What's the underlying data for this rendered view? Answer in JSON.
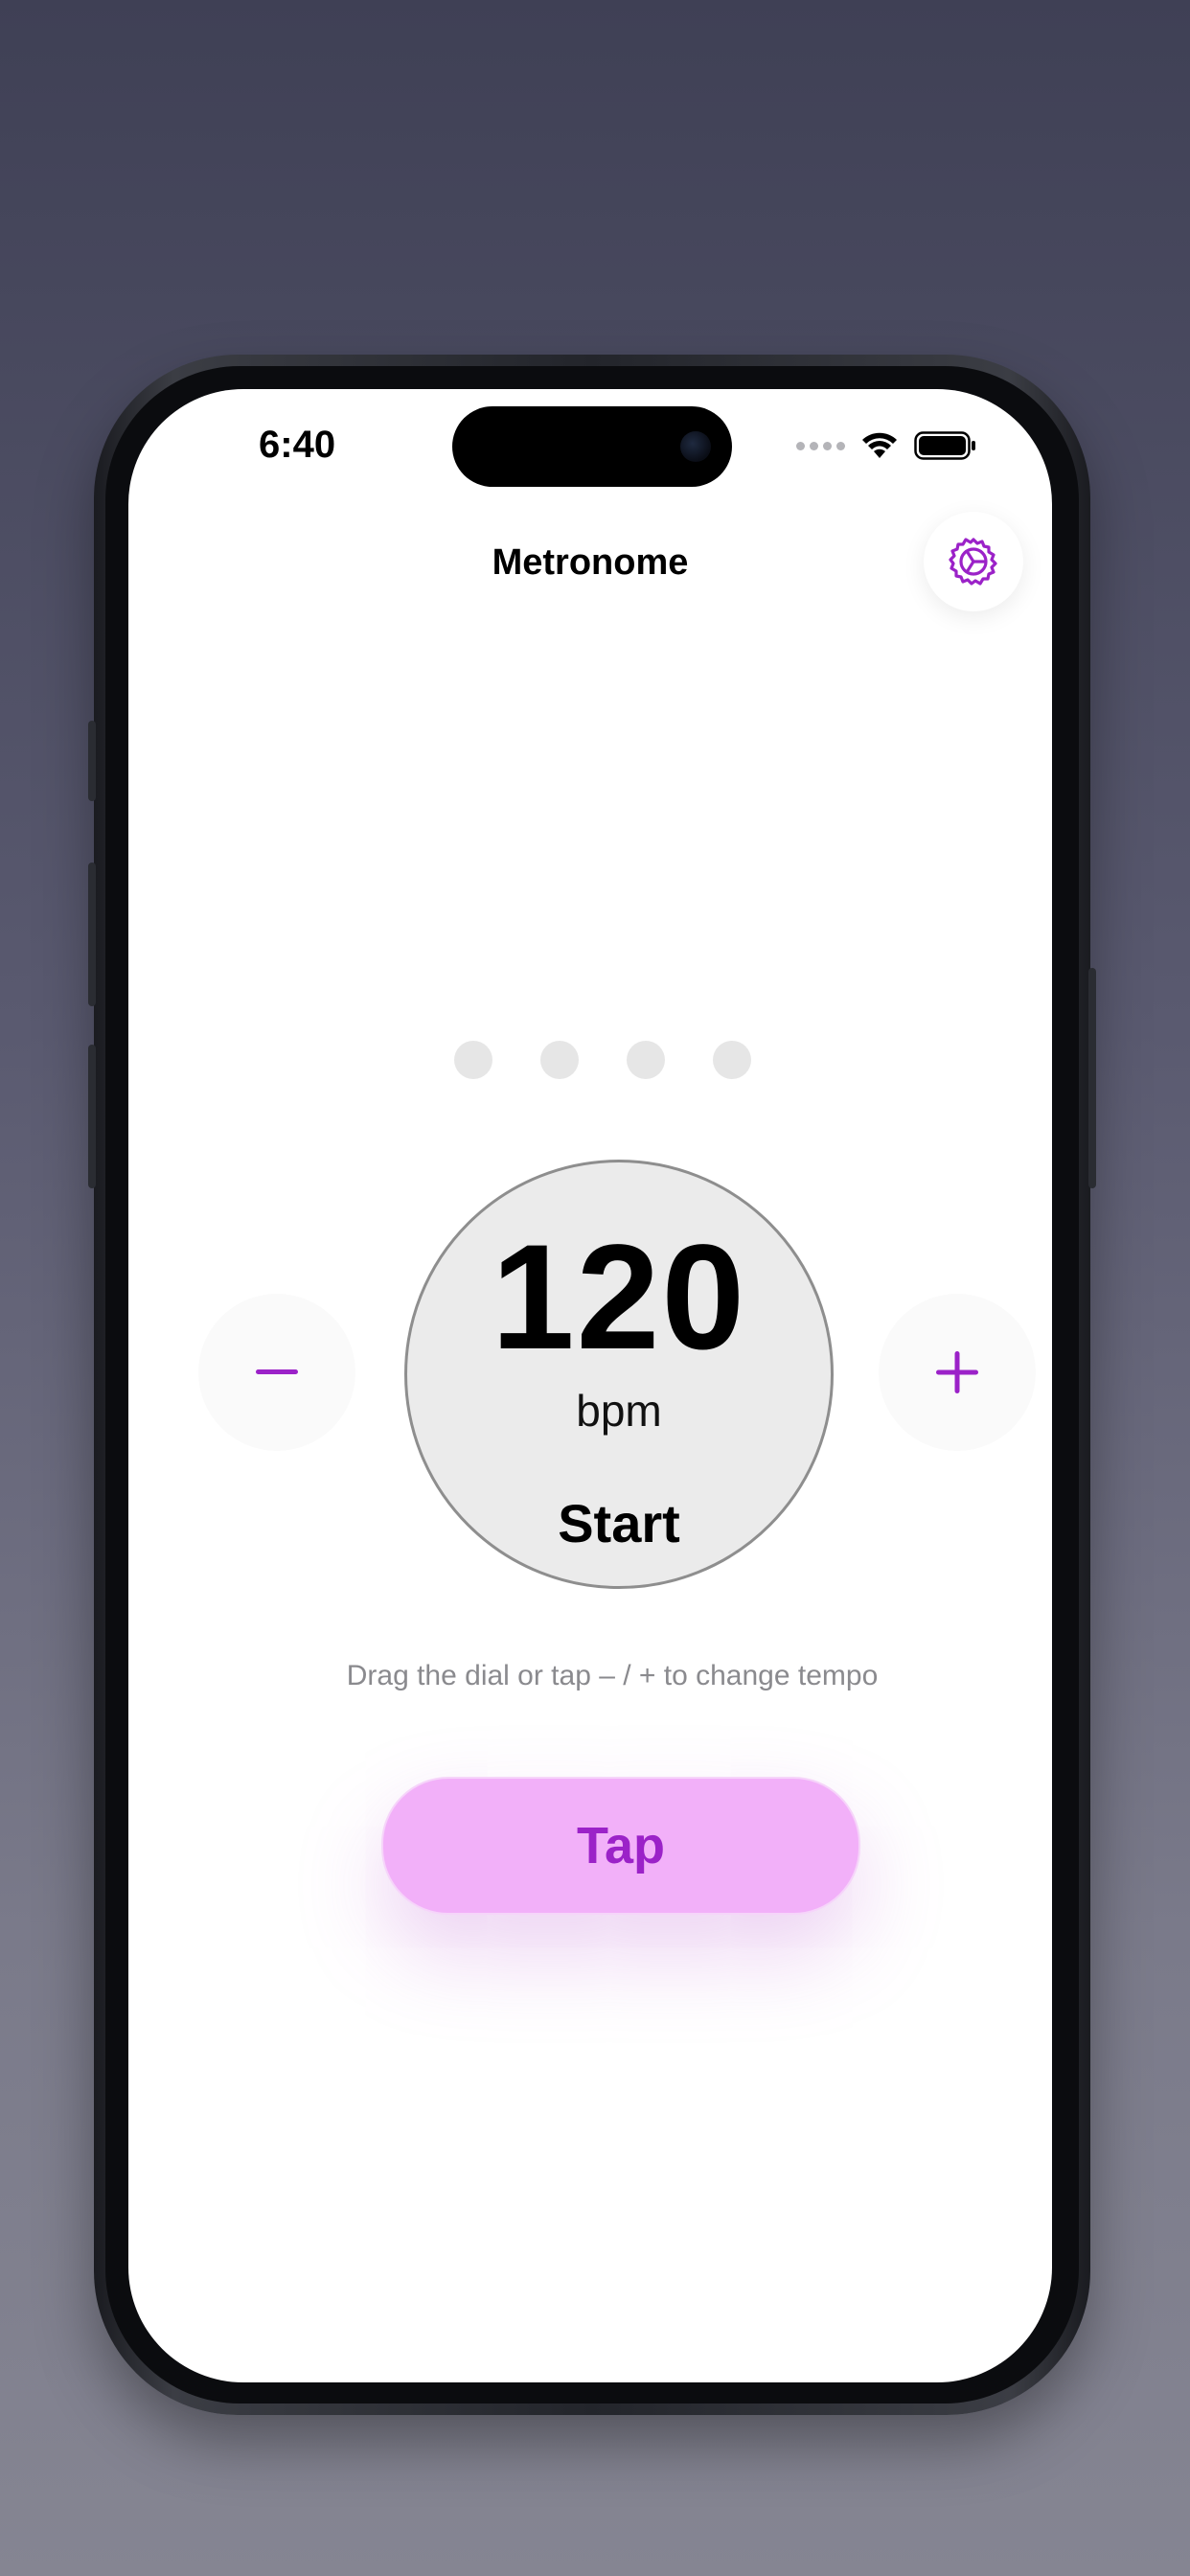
{
  "status_bar": {
    "time": "6:40"
  },
  "header": {
    "title": "Metronome",
    "settings_icon": "gear-icon"
  },
  "beats": {
    "count": 4,
    "active_index": null
  },
  "dial": {
    "bpm_value": "120",
    "bpm_unit": "bpm",
    "action_label": "Start"
  },
  "controls": {
    "decrement_label": "−",
    "increment_label": "+"
  },
  "hint": "Drag the dial or tap – / + to change tempo",
  "tap_button": {
    "label": "Tap"
  },
  "colors": {
    "accent": "#9b22c8",
    "tap_background": "#f2b0f9",
    "dial_background": "#ebebeb",
    "beat_inactive": "#e6e6e6"
  }
}
